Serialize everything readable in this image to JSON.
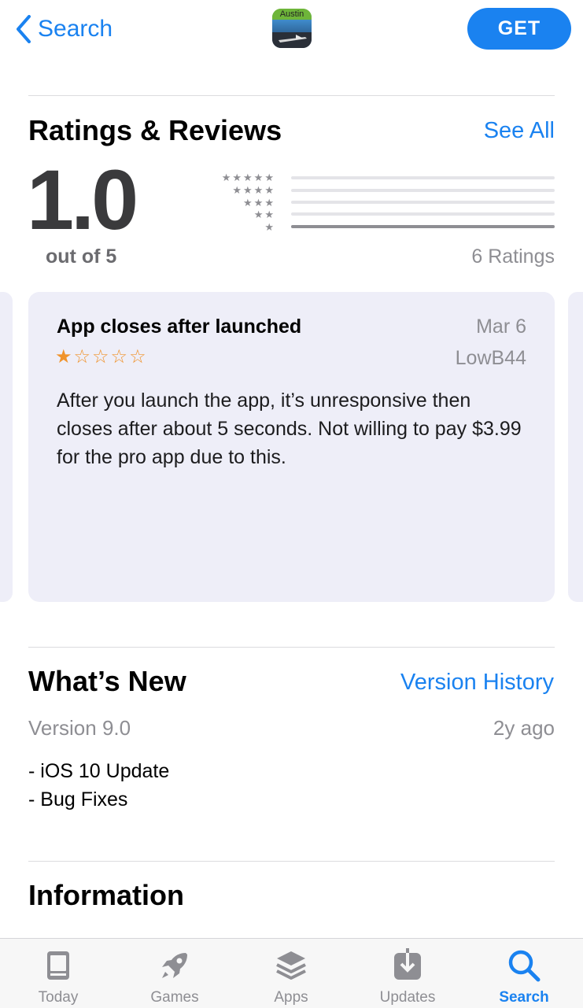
{
  "nav": {
    "back_label": "Search",
    "app_icon_text": "Austin",
    "get_label": "GET"
  },
  "ratings": {
    "title": "Ratings & Reviews",
    "see_all": "See All",
    "average": "1.0",
    "out_of": "out of 5",
    "count": "6 Ratings",
    "distribution": [
      {
        "stars": "★★★★★",
        "fraction": 0
      },
      {
        "stars": "★★★★",
        "fraction": 0
      },
      {
        "stars": "★★★",
        "fraction": 0
      },
      {
        "stars": "★★",
        "fraction": 0
      },
      {
        "stars": "★",
        "fraction": 1.0
      }
    ]
  },
  "review": {
    "title": "App closes after launched",
    "date": "Mar 6",
    "author": "LowB44",
    "rating": 1,
    "stars_text": "★☆☆☆☆",
    "body": "After you launch the app, it’s unresponsive then closes after about 5 seconds. Not willing to pay $3.99 for the pro app due to this."
  },
  "whats_new": {
    "title": "What’s New",
    "history_link": "Version History",
    "version": "Version 9.0",
    "age": "2y ago",
    "notes": [
      "- iOS 10 Update",
      "- Bug Fixes"
    ]
  },
  "information": {
    "title": "Information"
  },
  "tabbar": {
    "items": [
      {
        "label": "Today",
        "icon": "today-icon",
        "active": false
      },
      {
        "label": "Games",
        "icon": "rocket-icon",
        "active": false
      },
      {
        "label": "Apps",
        "icon": "layers-icon",
        "active": false
      },
      {
        "label": "Updates",
        "icon": "download-icon",
        "active": false
      },
      {
        "label": "Search",
        "icon": "search-icon",
        "active": true
      }
    ]
  },
  "colors": {
    "accent": "#1a82f0",
    "star_orange": "#f0932b",
    "card_bg": "#eeeef8"
  }
}
